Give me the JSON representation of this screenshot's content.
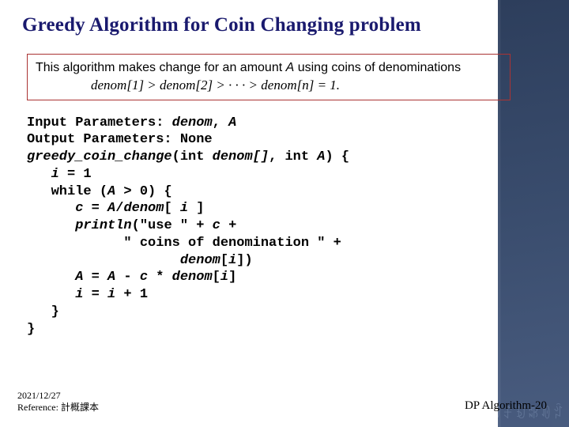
{
  "title": "Greedy Algorithm for Coin Changing problem",
  "desc": {
    "line1a": "This algorithm makes change for an amount ",
    "line1_A": "A",
    "line1b": " using coins of denominations",
    "formula": "denom[1] > denom[2] > · · · > denom[n] = 1."
  },
  "code": {
    "l1a": "Input Parameters: ",
    "l1b": "denom",
    "l1c": ", ",
    "l1d": "A",
    "l2": "Output Parameters: None",
    "l3a": "greedy_coin_change",
    "l3b": "(int ",
    "l3c": "denom[]",
    "l3d": ", int ",
    "l3e": "A",
    "l3f": ") {",
    "l4a": "   ",
    "l4b": "i",
    "l4c": " = 1",
    "l5a": "   while (",
    "l5b": "A",
    "l5c": " > 0) {",
    "l6a": "      ",
    "l6b": "c",
    "l6c": " = ",
    "l6d": "A",
    "l6e": "/",
    "l6f": "denom",
    "l6g": "[ ",
    "l6h": "i",
    "l6i": " ]",
    "l7a": "      ",
    "l7b": "println",
    "l7c": "(\"use \" + ",
    "l7d": "c",
    "l7e": " +",
    "l8": "            \" coins of denomination \" +",
    "l9a": "                   ",
    "l9b": "denom",
    "l9c": "[",
    "l9d": "i",
    "l9e": "])",
    "l10a": "      ",
    "l10b": "A",
    "l10c": " = ",
    "l10d": "A",
    "l10e": " - ",
    "l10f": "c",
    "l10g": " * ",
    "l10h": "denom",
    "l10i": "[",
    "l10j": "i",
    "l10k": "]",
    "l11a": "      ",
    "l11b": "i",
    "l11c": " = ",
    "l11d": "i",
    "l11e": " + 1",
    "l12": "   }",
    "l13": "}"
  },
  "footer": {
    "date": "2021/12/27",
    "ref": "Reference: 計概課本",
    "right": "DP Algorithm-20"
  }
}
